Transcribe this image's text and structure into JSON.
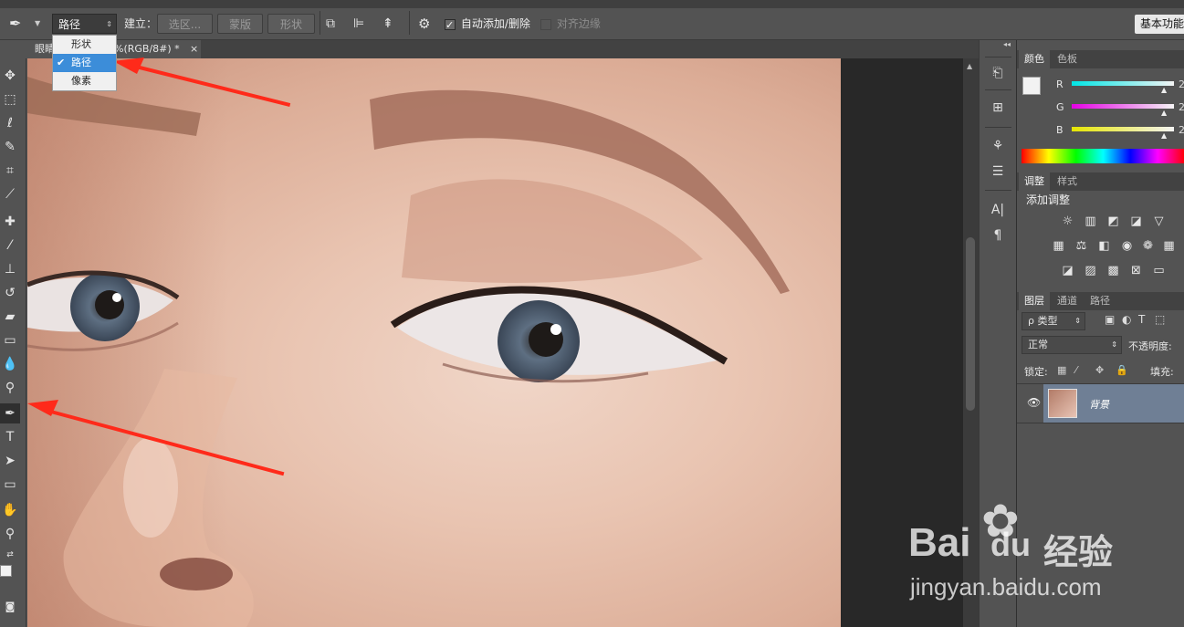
{
  "options_bar": {
    "pen_icon": "pen-icon",
    "mode_select_value": "路径",
    "make_label": "建立：",
    "selection_btn": "选区...",
    "mask_btn": "蒙版",
    "shape_btn": "形状",
    "auto_add_delete_label": "自动添加/删除",
    "align_edges_label": "对齐边缘",
    "workspace_btn": "基本功能"
  },
  "mode_dropdown": {
    "items": [
      {
        "label": "形状",
        "selected": false
      },
      {
        "label": "路径",
        "selected": true
      },
      {
        "label": "像素",
        "selected": false
      }
    ]
  },
  "document_tabs": {
    "tab1_label": "眼睛",
    "tab2_label": "0%(RGB/8#) *",
    "close_glyph": "×"
  },
  "color_panel": {
    "tabs": [
      "颜色",
      "色板"
    ],
    "channels": [
      "R",
      "G",
      "B"
    ],
    "channel_value_prefix": "2"
  },
  "adjustments_panel": {
    "tabs": [
      "调整",
      "样式"
    ],
    "title": "添加调整"
  },
  "layers_panel": {
    "tabs": [
      "图层",
      "通道",
      "路径"
    ],
    "filter_label": "ρ 类型",
    "blend_mode": "正常",
    "opacity_label": "不透明度:",
    "lock_label": "锁定:",
    "fill_label": "填充:",
    "layer_name": "背景"
  },
  "watermark": {
    "brand_text": "Bai",
    "brand_text2": "du",
    "brand_cn": "经验",
    "url": "jingyan.baidu.com"
  },
  "colors": {
    "ui_bg": "#535353",
    "annotation_arrow": "#ff2a1a",
    "selection_blue": "#3c8dd9",
    "layer_selected": "#6f7f95"
  }
}
